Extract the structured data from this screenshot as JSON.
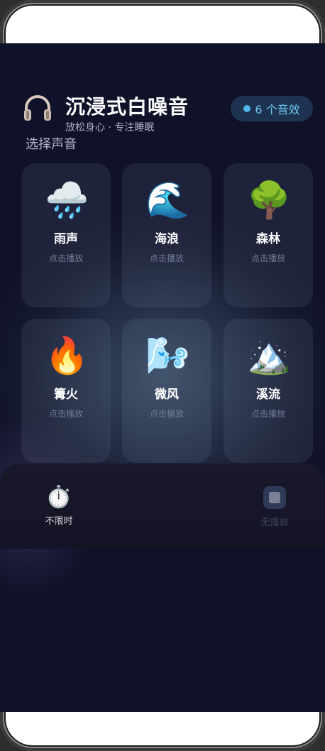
{
  "header": {
    "icon": "headphones-icon",
    "title": "沉浸式白噪音",
    "subtitle": "放松身心 · 专注睡眠",
    "badge": "6 个音效"
  },
  "section_label": "选择声音",
  "sounds": [
    {
      "emoji": "🌧️",
      "name": "雨声",
      "hint": "点击播放"
    },
    {
      "emoji": "🌊",
      "name": "海浪",
      "hint": "点击播放"
    },
    {
      "emoji": "🌳",
      "name": "森林",
      "hint": "点击播放"
    },
    {
      "emoji": "🔥",
      "name": "篝火",
      "hint": "点击播放"
    },
    {
      "emoji": "🌬️",
      "name": "微风",
      "hint": "点击播放"
    },
    {
      "emoji": "🏔️",
      "name": "溪流",
      "hint": "点击播放"
    }
  ],
  "controls": {
    "timer_icon": "⏱️",
    "timer_label": "不限时",
    "stop_label": "无播放"
  },
  "colors": {
    "accent": "#4fb6ee",
    "badge_bg": "#1e3350",
    "screen_bg": "#10122a"
  }
}
